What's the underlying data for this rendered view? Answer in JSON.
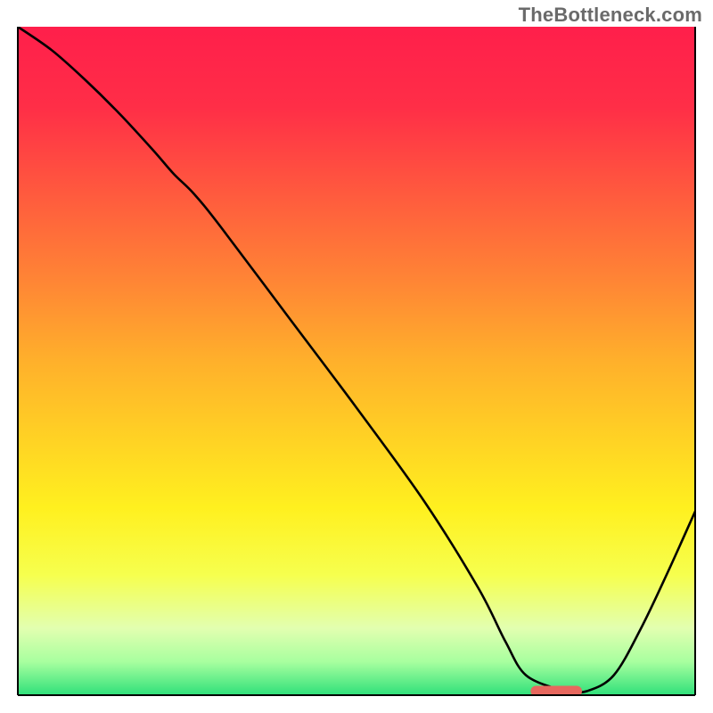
{
  "watermark": "TheBottleneck.com",
  "chart_data": {
    "type": "line",
    "title": "",
    "xlabel": "",
    "ylabel": "",
    "xlim": [
      0,
      100
    ],
    "ylim": [
      0,
      100
    ],
    "legend": false,
    "grid": false,
    "background_gradient": {
      "stops": [
        {
          "offset": 0.0,
          "color": "#ff1f4b"
        },
        {
          "offset": 0.12,
          "color": "#ff2e47"
        },
        {
          "offset": 0.25,
          "color": "#ff5a3e"
        },
        {
          "offset": 0.38,
          "color": "#ff8535"
        },
        {
          "offset": 0.5,
          "color": "#ffb02b"
        },
        {
          "offset": 0.62,
          "color": "#ffd324"
        },
        {
          "offset": 0.72,
          "color": "#fff01f"
        },
        {
          "offset": 0.82,
          "color": "#f6ff4e"
        },
        {
          "offset": 0.9,
          "color": "#e2ffb0"
        },
        {
          "offset": 0.95,
          "color": "#a8ff9f"
        },
        {
          "offset": 1.0,
          "color": "#2fe07a"
        }
      ]
    },
    "series": [
      {
        "name": "bottleneck-curve",
        "color": "#000000",
        "x": [
          0.0,
          5.0,
          10.0,
          15.0,
          20.0,
          23.0,
          26.0,
          30.0,
          40.0,
          50.0,
          60.0,
          68.0,
          72.0,
          75.0,
          80.0,
          81.0,
          84.0,
          88.0,
          92.0,
          96.0,
          100.0
        ],
        "y": [
          100.0,
          96.5,
          92.0,
          87.0,
          81.5,
          78.0,
          75.0,
          70.0,
          56.5,
          43.0,
          29.0,
          16.0,
          8.0,
          3.0,
          0.8,
          0.6,
          0.6,
          3.0,
          10.0,
          18.5,
          27.5
        ]
      }
    ],
    "marker": {
      "name": "optimal-range",
      "color": "#e7685e",
      "x_start": 76.5,
      "x_end": 82.5,
      "y": 0.6,
      "thickness": 1.6
    },
    "axes_frame": {
      "left": true,
      "right": true,
      "top": false,
      "bottom": true,
      "color": "#000000",
      "width": 2
    }
  }
}
